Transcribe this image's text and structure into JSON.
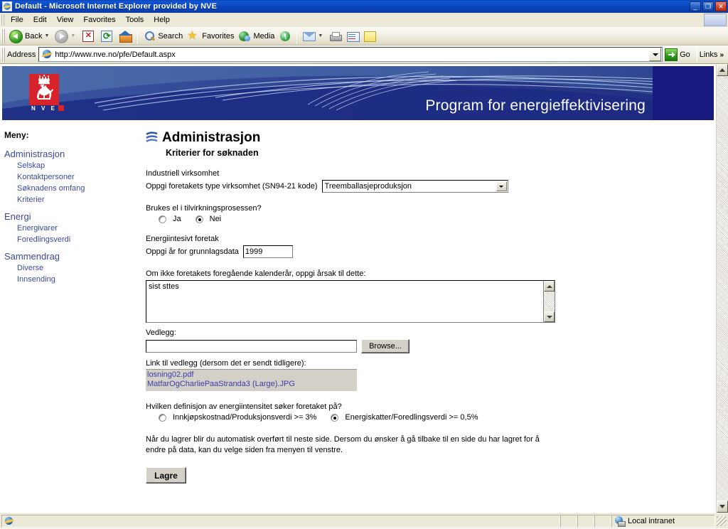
{
  "window": {
    "title": "Default - Microsoft Internet Explorer provided by NVE",
    "minimize_label": "_",
    "restore_label": "❐",
    "close_label": "✕"
  },
  "menubar": {
    "items": [
      {
        "label": "File"
      },
      {
        "label": "Edit"
      },
      {
        "label": "View"
      },
      {
        "label": "Favorites"
      },
      {
        "label": "Tools"
      },
      {
        "label": "Help"
      }
    ]
  },
  "toolbar": {
    "back_label": "Back",
    "search_label": "Search",
    "favorites_label": "Favorites",
    "media_label": "Media"
  },
  "address": {
    "label": "Address",
    "url": "http://www.nve.no/pfe/Default.aspx",
    "placeholder": "",
    "go_label": "Go",
    "links_label": "Links",
    "links_chevron": "»"
  },
  "banner": {
    "title": "Program for energieffektivisering",
    "logo_word": "N V E"
  },
  "sidebar": {
    "heading": "Meny:",
    "groups": [
      {
        "top": "Administrasjon",
        "items": [
          "Selskap",
          "Kontaktpersoner",
          "Søknadens omfang",
          "Kriterier"
        ]
      },
      {
        "top": "Energi",
        "items": [
          "Energivarer",
          "Foredlingsverdi"
        ]
      },
      {
        "top": "Sammendrag",
        "items": [
          "Diverse",
          "Innsending"
        ]
      }
    ]
  },
  "main": {
    "page_title": "Administrasjon",
    "page_subtitle": "Kriterier for søknaden",
    "section_industry_label": "Industriell virksomhet",
    "industry_field_label": "Oppgi foretakets type virksomhet (SN94-21 kode)",
    "industry_value": "Treemballasjeproduksjon",
    "electricity_question": "Brukes el i tilvirkningsprosessen?",
    "electricity_options": [
      {
        "label": "Ja",
        "checked": false
      },
      {
        "label": "Nei",
        "checked": true
      }
    ],
    "section_energy_label": "Energiintesivt foretak",
    "year_field_label": "Oppgi år for grunnlagsdata",
    "year_value": "1999",
    "reason_label": "Om ikke foretakets foregående kalenderår, oppgi årsak til dette:",
    "reason_value": "sist sttes",
    "attachment_label": "Vedlegg:",
    "attachment_value": "",
    "browse_label": "Browse...",
    "link_list_label": "Link til vedlegg (dersom det er sendt tidligere):",
    "attached_files": [
      "losning02.pdf",
      "MatfarOgCharliePaaStranda3 (Large).JPG"
    ],
    "definition_question": "Hvilken definisjon av energiintensitet søker foretaket på?",
    "definition_options": [
      {
        "label": "Innkjøpskostnad/Produksjonsverdi >= 3%",
        "checked": false
      },
      {
        "label": "Energiskatter/Foredlingsverdi >= 0,5%",
        "checked": true
      }
    ],
    "note": "Når du lagrer blir du automatisk overført til neste side. Dersom du ønsker å gå tilbake til en side du har lagret for å endre på data, kan du velge siden fra menyen til venstre.",
    "save_label": "Lagre"
  },
  "statusbar": {
    "message": "",
    "zone": "Local intranet"
  },
  "colors": {
    "titlebar_blue": "#0a47bd",
    "banner_blue": "#4b6bab",
    "banner_dark": "#17197e",
    "nav_link": "#3b4a9e",
    "file_link": "#3b3bad",
    "logo_red": "#d9232a",
    "chrome_beige": "#ece9d8"
  }
}
